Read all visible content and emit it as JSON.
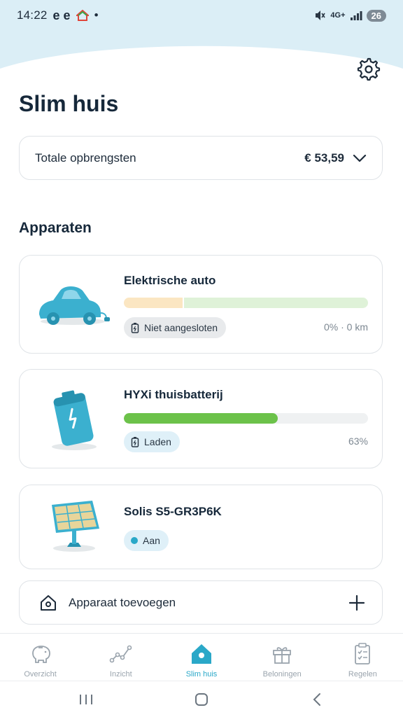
{
  "status_bar": {
    "time": "14:22",
    "app_glyphs": "e e",
    "dot": "•",
    "network": "4G+",
    "battery": "26"
  },
  "header": {
    "title": "Slim huis",
    "settings_icon": "gear-icon"
  },
  "earnings": {
    "label": "Totale opbrengsten",
    "value": "€ 53,59"
  },
  "devices_section": {
    "title": "Apparaten",
    "devices": [
      {
        "name": "Elektrische auto",
        "status": "Niet aangesloten",
        "meta": "0% · 0 km",
        "charge_level": 0,
        "colors": {
          "bar_left": "#fbe6c2",
          "bar_right": "#dff2d8"
        }
      },
      {
        "name": "HYXi thuisbatterij",
        "status": "Laden",
        "meta": "63%",
        "charge_level": 0.63,
        "colors": {
          "fill": "#6cc24a",
          "track": "#eff1f2"
        }
      },
      {
        "name": "Solis S5-GR3P6K",
        "status": "Aan",
        "colors": {
          "dot": "#2aa8c8"
        }
      }
    ],
    "add_device_label": "Apparaat toevoegen"
  },
  "tabs": [
    {
      "label": "Overzicht",
      "icon": "piggy-bank-icon"
    },
    {
      "label": "Inzicht",
      "icon": "line-chart-icon"
    },
    {
      "label": "Slim huis",
      "icon": "house-icon",
      "active": true
    },
    {
      "label": "Beloningen",
      "icon": "gift-icon"
    },
    {
      "label": "Regelen",
      "icon": "clipboard-icon"
    }
  ],
  "colors": {
    "accent": "#2aa8c8",
    "header_bg": "#dbeef6",
    "title": "#16283a"
  }
}
